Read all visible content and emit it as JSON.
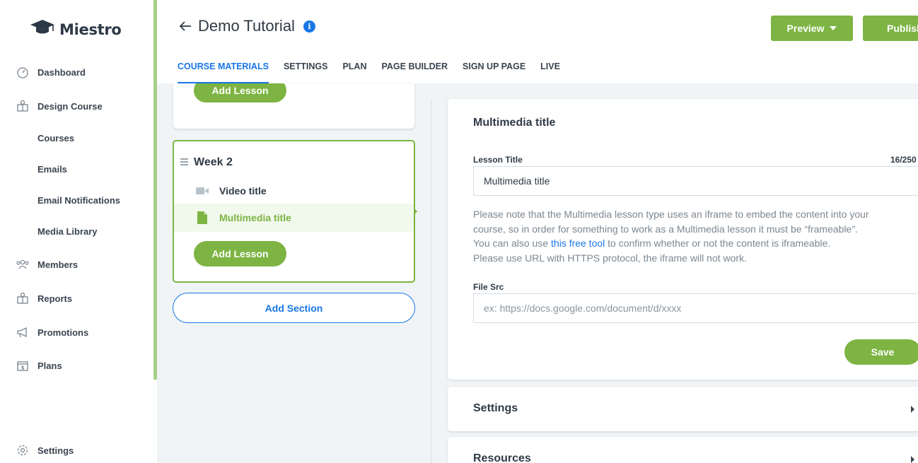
{
  "app": {
    "name": "Miestro"
  },
  "sidebar": {
    "items": [
      {
        "label": "Dashboard",
        "icon": "dashboard-gauge-icon"
      },
      {
        "label": "Design Course",
        "icon": "design-course-icon"
      },
      {
        "label": "Members",
        "icon": "members-icon"
      },
      {
        "label": "Reports",
        "icon": "reports-icon"
      },
      {
        "label": "Promotions",
        "icon": "megaphone-icon"
      },
      {
        "label": "Plans",
        "icon": "plans-icon"
      },
      {
        "label": "Settings",
        "icon": "gear-icon"
      }
    ],
    "subitems": [
      "Courses",
      "Emails",
      "Email Notifications",
      "Media Library"
    ]
  },
  "header": {
    "title": "Demo Tutorial",
    "preview_label": "Preview",
    "publish_label": "Publish",
    "tabs": [
      "COURSE MATERIALS",
      "SETTINGS",
      "PLAN",
      "PAGE BUILDER",
      "SIGN UP PAGE",
      "LIVE"
    ],
    "active_tab": "COURSE MATERIALS"
  },
  "outline": {
    "add_lesson_label": "Add Lesson",
    "week_title": "Week 2",
    "lessons": [
      {
        "label": "Video title",
        "icon": "video-camera-icon"
      },
      {
        "label": "Multimedia title",
        "icon": "document-icon",
        "active": true
      }
    ],
    "add_section_label": "Add Section"
  },
  "editor": {
    "panel_title": "Multimedia title",
    "lesson_title_label": "Lesson Title",
    "lesson_title_counter": "16/250",
    "lesson_title_value": "Multimedia title",
    "note_line1": "Please note that the Multimedia lesson type uses an iframe to embed the content into your",
    "note_line2": "course, so in order for something to work as a Multimedia lesson it must be “frameable”.",
    "note_line3_pre": "You can also use ",
    "note_link": "this free tool",
    "note_line3_post": " to confirm whether or not the content is iframeable.",
    "note_line4": "Please use URL with HTTPS protocol, the iframe will not work.",
    "file_src_label": "File Src",
    "file_src_placeholder": "ex: https://docs.google.com/document/d/xxxx",
    "save_label": "Save",
    "accordions": [
      "Settings",
      "Resources"
    ]
  },
  "colors": {
    "accent_green": "#7db443",
    "link_blue": "#1877e6"
  }
}
